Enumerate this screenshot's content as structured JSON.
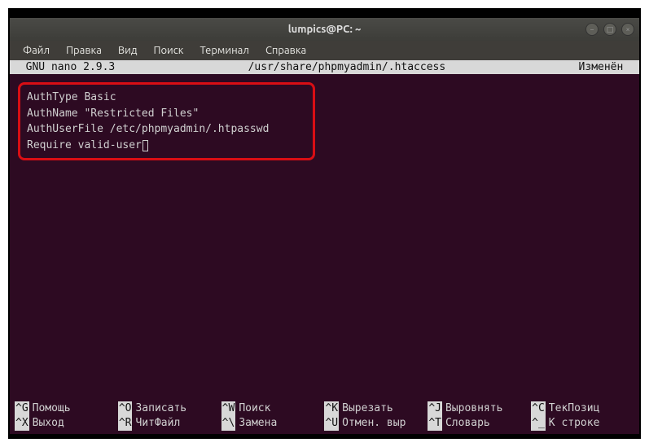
{
  "window": {
    "title": "lumpics@PC: ~"
  },
  "menubar": {
    "items": [
      {
        "label": "Файл"
      },
      {
        "label": "Правка"
      },
      {
        "label": "Вид"
      },
      {
        "label": "Поиск"
      },
      {
        "label": "Терминал"
      },
      {
        "label": "Справка"
      }
    ]
  },
  "nano": {
    "app": "  GNU nano 2.9.3",
    "filepath": "/usr/share/phpmyadmin/.htaccess",
    "status": "Изменён  "
  },
  "editor": {
    "lines": [
      "AuthType Basic",
      "AuthName \"Restricted Files\"",
      "AuthUserFile /etc/phpmyadmin/.htpasswd",
      "Require valid-user"
    ]
  },
  "shortcuts": {
    "row1": [
      {
        "key": "^G",
        "label": "Помощь"
      },
      {
        "key": "^O",
        "label": "Записать"
      },
      {
        "key": "^W",
        "label": "Поиск"
      },
      {
        "key": "^K",
        "label": "Вырезать"
      },
      {
        "key": "^J",
        "label": "Выровнять"
      },
      {
        "key": "^C",
        "label": "ТекПозиц"
      }
    ],
    "row2": [
      {
        "key": "^X",
        "label": "Выход"
      },
      {
        "key": "^R",
        "label": "ЧитФайл"
      },
      {
        "key": "^\\",
        "label": "Замена"
      },
      {
        "key": "^U",
        "label": "Отмен. выр"
      },
      {
        "key": "^T",
        "label": "Словарь"
      },
      {
        "key": "^_",
        "label": "К строке"
      }
    ]
  }
}
